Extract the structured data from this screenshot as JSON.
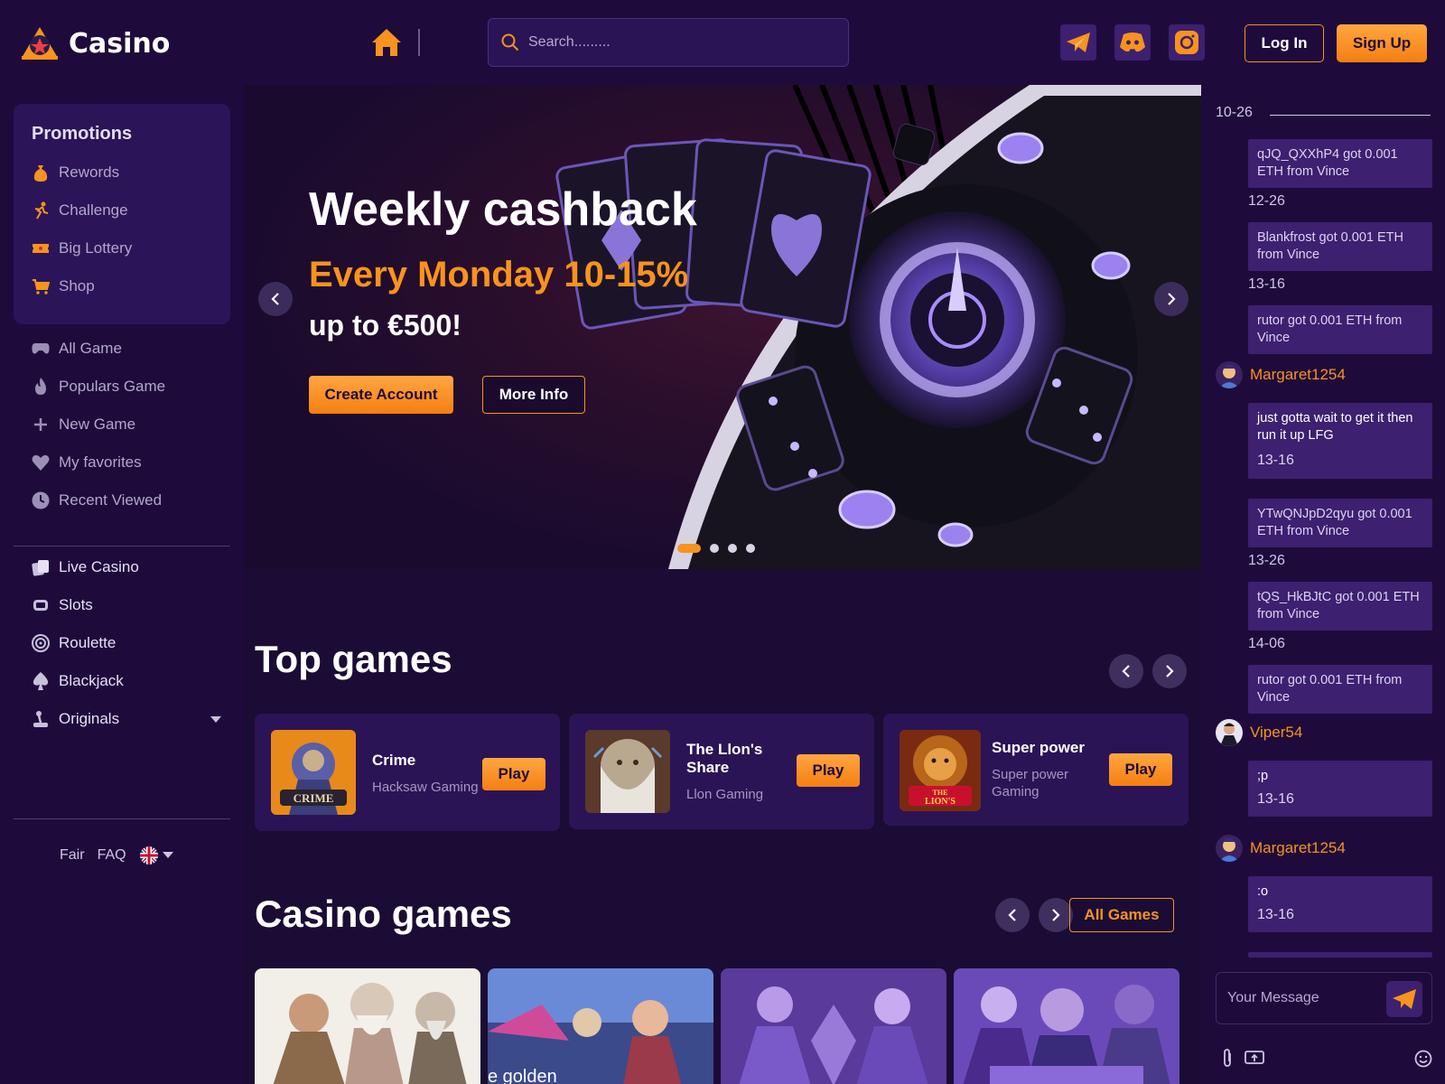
{
  "header": {
    "brand": "Casino",
    "search_placeholder": "Search.........",
    "login_label": "Log In",
    "signup_label": "Sign Up",
    "socials": [
      "telegram-icon",
      "discord-icon",
      "instagram-icon"
    ],
    "accent_color": "#f7931e"
  },
  "sidebar": {
    "promotions_title": "Promotions",
    "promotions": [
      {
        "label": "Rewords",
        "icon": "money-bag-icon"
      },
      {
        "label": "Challenge",
        "icon": "runner-icon"
      },
      {
        "label": "Big Lottery",
        "icon": "ticket-icon"
      },
      {
        "label": "Shop",
        "icon": "cart-icon"
      }
    ],
    "browse": [
      {
        "label": "All Game",
        "icon": "gamepad-icon"
      },
      {
        "label": "Populars Game",
        "icon": "fire-icon"
      },
      {
        "label": "New Game",
        "icon": "plus-icon"
      },
      {
        "label": "My favorites",
        "icon": "heart-icon"
      },
      {
        "label": "Recent Viewed",
        "icon": "clock-icon"
      }
    ],
    "categories": [
      {
        "label": "Live Casino",
        "icon": "cards-icon"
      },
      {
        "label": "Slots",
        "icon": "slot-icon"
      },
      {
        "label": "Roulette",
        "icon": "roulette-icon"
      },
      {
        "label": "Blackjack",
        "icon": "spade-icon"
      },
      {
        "label": "Originals",
        "icon": "joystick-icon"
      }
    ],
    "footer": {
      "fair": "Fair",
      "faq": "FAQ",
      "language_icon": "uk-flag-icon"
    }
  },
  "banner": {
    "title": "Weekly cashback",
    "subtitle": "Every Monday 10-15%",
    "amount": "up to €500!",
    "create_label": "Create Account",
    "more_label": "More Info",
    "slide_count": 4,
    "active_slide": 1
  },
  "top_games": {
    "title": "Top games",
    "items": [
      {
        "name": "Crime",
        "provider": "Hacksaw Gaming",
        "play": "Play"
      },
      {
        "name": "The Llon's Share",
        "provider": "Llon Gaming",
        "play": "Play"
      },
      {
        "name": "Super power",
        "provider": "Super power Gaming",
        "play": "Play"
      }
    ]
  },
  "casino_games": {
    "title": "Casino games",
    "all_label": "All Games",
    "tile_text": "e golden"
  },
  "chat": {
    "messages": [
      {
        "type": "time",
        "text": "10-26"
      },
      {
        "type": "msg",
        "text": "qJQ_QXXhP4 got 0.001 ETH from Vince"
      },
      {
        "type": "time",
        "text": "12-26"
      },
      {
        "type": "msg",
        "text": "Blankfrost got 0.001 ETH from Vince"
      },
      {
        "type": "time",
        "text": "13-16"
      },
      {
        "type": "msg",
        "text": "rutor got 0.001 ETH from Vince"
      },
      {
        "type": "user",
        "text": "Margaret1254"
      },
      {
        "type": "msg",
        "text": "just gotta wait to get it then run it up LFG",
        "time": "13-16"
      },
      {
        "type": "msg",
        "text": "YTwQNJpD2qyu got 0.001 ETH from Vince"
      },
      {
        "type": "time",
        "text": "13-26"
      },
      {
        "type": "msg",
        "text": "tQS_HkBJtC got 0.001 ETH from Vince"
      },
      {
        "type": "time",
        "text": "14-06"
      },
      {
        "type": "msg",
        "text": "rutor got 0.001 ETH from Vince"
      },
      {
        "type": "user",
        "text": "Viper54"
      },
      {
        "type": "msg",
        "text": ";p",
        "time": "13-16"
      },
      {
        "type": "user",
        "text": "Margaret1254"
      },
      {
        "type": "msg",
        "text": ":o",
        "time": "13-16"
      }
    ],
    "input_placeholder": "Your Message"
  }
}
